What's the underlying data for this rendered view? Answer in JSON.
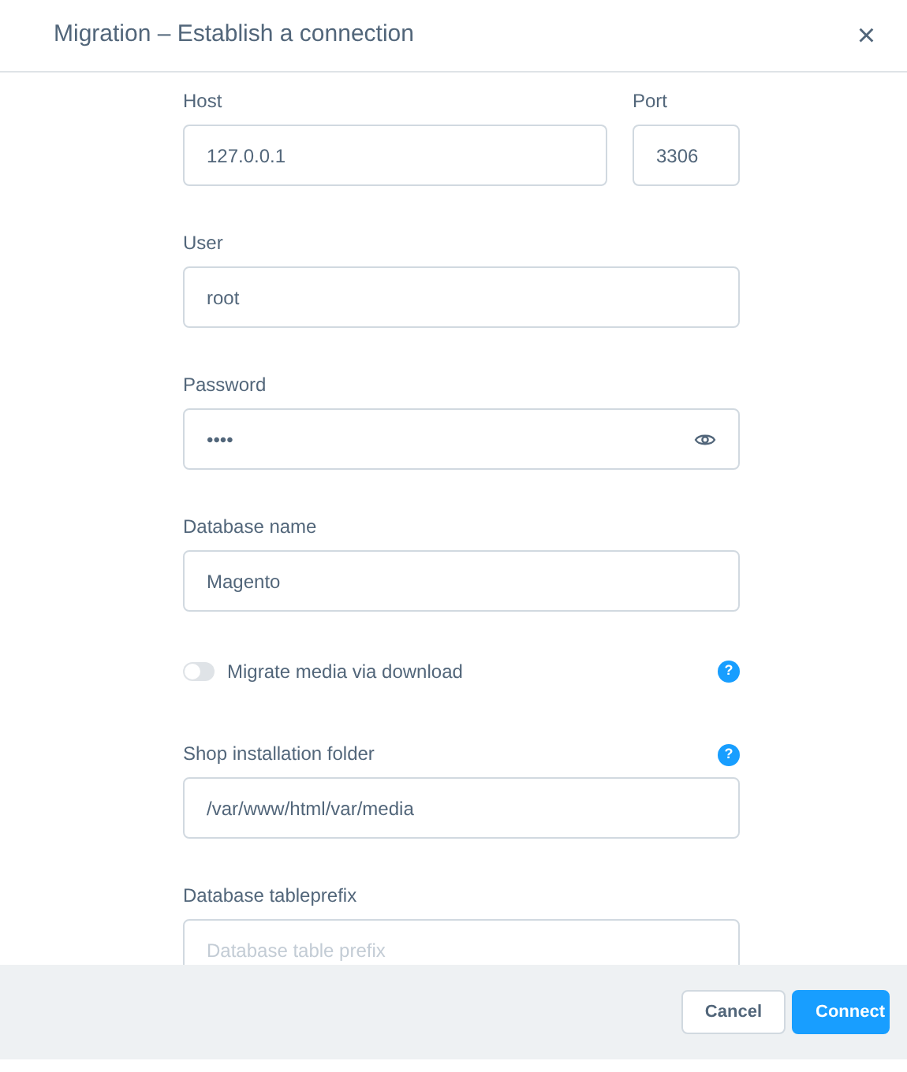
{
  "dialog": {
    "title": "Migration – Establish a connection",
    "close": "×"
  },
  "rows": [
    {
      "kind": "pair",
      "fields": [
        {
          "label": "Host",
          "value": "127.0.0.1"
        },
        {
          "label": "Port",
          "value": "3306"
        }
      ]
    },
    {
      "kind": "text",
      "label": "User",
      "value": "root"
    },
    {
      "kind": "password",
      "label": "Password",
      "value": "••••"
    },
    {
      "kind": "text",
      "label": "Database name",
      "value": "Magento"
    },
    {
      "kind": "toggle",
      "label": "Migrate media via download",
      "on": false,
      "help": "?"
    },
    {
      "kind": "text",
      "label": "Shop installation folder",
      "value": "/var/www/html/var/media",
      "help": "?"
    },
    {
      "kind": "text",
      "label": "Database tableprefix",
      "placeholder": "Database table prefix"
    }
  ],
  "buttons": [
    {
      "label": "Cancel",
      "primary": false
    },
    {
      "label": "Connect",
      "primary": true
    }
  ]
}
